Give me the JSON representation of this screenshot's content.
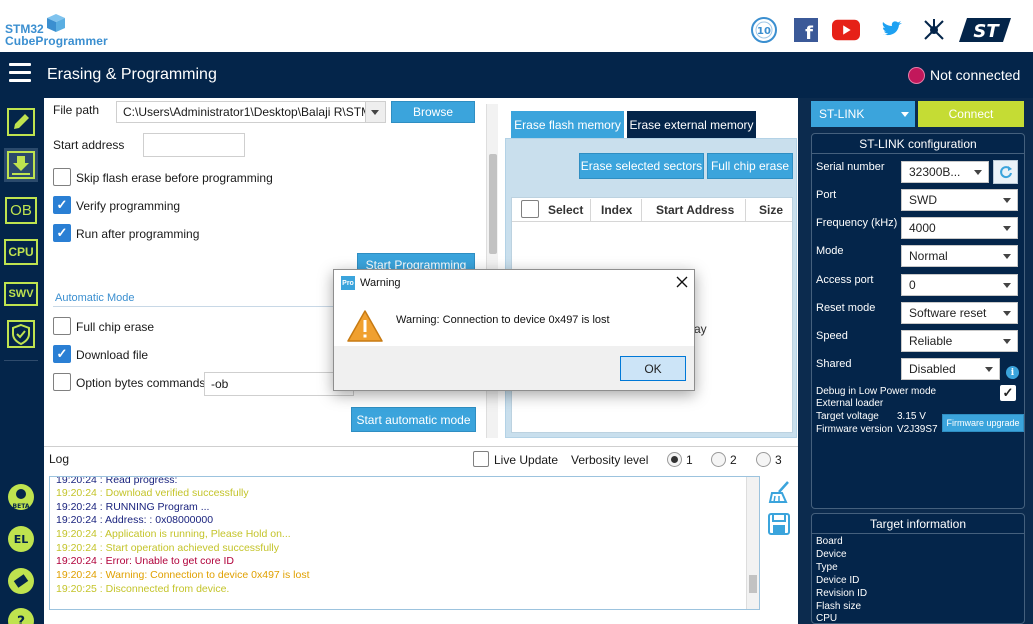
{
  "brand": {
    "logo_line1": "STM32",
    "logo_line2": "CubeProgrammer",
    "social_icons": [
      "anniversary-10-icon",
      "facebook-icon",
      "youtube-icon",
      "twitter-icon",
      "network-icon",
      "st-logo-icon"
    ]
  },
  "header": {
    "title": "Erasing & Programming",
    "connection_status": "Not connected",
    "status_color": "#c2185b"
  },
  "sidebar": {
    "items": [
      {
        "icon": "edit-icon",
        "label": ""
      },
      {
        "icon": "download-icon",
        "label": ""
      },
      {
        "icon": "ob-icon",
        "label": "OB"
      },
      {
        "icon": "cpu-icon",
        "label": "CPU"
      },
      {
        "icon": "swv-icon",
        "label": "SWV"
      },
      {
        "icon": "security-shield-icon",
        "label": ""
      },
      {
        "icon": "beta-icon",
        "label": "BETA"
      },
      {
        "icon": "el-icon",
        "label": "EL"
      },
      {
        "icon": "eraser-icon",
        "label": ""
      },
      {
        "icon": "help-icon",
        "label": "?"
      }
    ]
  },
  "download": {
    "file_path_label": "File path",
    "file_path_value": "C:\\Users\\Administrator1\\Desktop\\Balaji R\\STM",
    "browse_label": "Browse",
    "start_address_label": "Start address",
    "start_address_value": "",
    "options": [
      {
        "label": "Skip flash erase before programming",
        "checked": false
      },
      {
        "label": "Verify programming",
        "checked": true
      },
      {
        "label": "Run after programming",
        "checked": true
      }
    ],
    "start_programming_label": "Start Programming"
  },
  "automatic": {
    "section_label": "Automatic Mode",
    "options": [
      {
        "label": "Full chip erase",
        "checked": false
      },
      {
        "label": "Download file",
        "checked": true
      },
      {
        "label": "Option bytes commands",
        "checked": false
      }
    ],
    "ob_value": "-ob",
    "start_label": "Start automatic mode"
  },
  "erase": {
    "tabs": [
      "Erase flash memory",
      "Erase external memory"
    ],
    "erase_selected_label": "Erase selected sectors",
    "full_chip_label": "Full chip erase",
    "columns": [
      "Select",
      "Index",
      "Start Address",
      "Size"
    ],
    "hidden_fragment": "ay"
  },
  "log": {
    "title": "Log",
    "live_update_label": "Live Update",
    "verbosity_label": "Verbosity level",
    "levels": [
      "1",
      "2",
      "3"
    ],
    "selected_level": "1",
    "lines": [
      {
        "text": "19:20:24 : Read progress:",
        "color": "#1a237e"
      },
      {
        "text": "19:20:24 : Download verified successfully",
        "color": "#c4c42a"
      },
      {
        "text": "19:20:24 : RUNNING Program ...",
        "color": "#1a237e"
      },
      {
        "text": "19:20:24 :   Address:      : 0x08000000",
        "color": "#1a237e"
      },
      {
        "text": "19:20:24 : Application is running, Please Hold on...",
        "color": "#c4c42a"
      },
      {
        "text": "19:20:24 : Start operation achieved successfully",
        "color": "#c4c42a"
      },
      {
        "text": "19:20:24 : Error: Unable to get core ID",
        "color": "#b0003a"
      },
      {
        "text": "19:20:24 : Warning: Connection to device 0x497 is lost",
        "color": "#e0a000"
      },
      {
        "text": "19:20:25 : Disconnected from device.",
        "color": "#c4c42a"
      }
    ]
  },
  "probe": {
    "interface": "ST-LINK",
    "connect_label": "Connect",
    "config_title": "ST-LINK configuration",
    "fields": [
      {
        "label": "Serial number",
        "value": "32300B..."
      },
      {
        "label": "Port",
        "value": "SWD"
      },
      {
        "label": "Frequency (kHz)",
        "value": "4000"
      },
      {
        "label": "Mode",
        "value": "Normal"
      },
      {
        "label": "Access port",
        "value": "0"
      },
      {
        "label": "Reset mode",
        "value": "Software reset"
      },
      {
        "label": "Speed",
        "value": "Reliable"
      },
      {
        "label": "Shared",
        "value": "Disabled"
      }
    ],
    "debug_low_power_label": "Debug in Low Power mode",
    "external_loader_label": "External loader",
    "target_voltage_label": "Target voltage",
    "target_voltage_value": "3.15 V",
    "firmware_version_label": "Firmware version",
    "firmware_version_value": "V2J39S7",
    "firmware_upgrade_label": "Firmware upgrade"
  },
  "target": {
    "title": "Target information",
    "fields": [
      "Board",
      "Device",
      "Type",
      "Device ID",
      "Revision ID",
      "Flash size",
      "CPU"
    ]
  },
  "dialog": {
    "title": "Warning",
    "app_icon_text": "Pro",
    "message": "Warning: Connection to device 0x497 is lost",
    "ok_label": "OK"
  }
}
